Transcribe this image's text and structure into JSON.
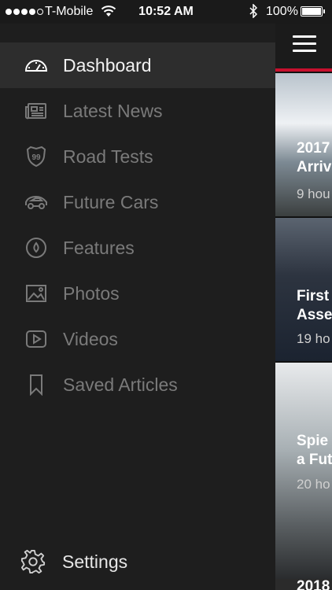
{
  "status_bar": {
    "carrier": "T-Mobile",
    "time": "10:52 AM",
    "battery": "100%"
  },
  "menu": {
    "items": [
      {
        "label": "Dashboard",
        "icon": "speedometer-icon",
        "active": true
      },
      {
        "label": "Latest News",
        "icon": "newspaper-icon",
        "active": false
      },
      {
        "label": "Road Tests",
        "icon": "highway-99-icon",
        "active": false
      },
      {
        "label": "Future Cars",
        "icon": "car-icon",
        "active": false
      },
      {
        "label": "Features",
        "icon": "target-icon",
        "active": false
      },
      {
        "label": "Photos",
        "icon": "photo-icon",
        "active": false
      },
      {
        "label": "Videos",
        "icon": "play-icon",
        "active": false
      },
      {
        "label": "Saved Articles",
        "icon": "bookmark-icon",
        "active": false
      }
    ],
    "road_tests_badge": "99",
    "settings_label": "Settings"
  },
  "articles": [
    {
      "title_line1": "2017",
      "title_line2": "Arriv",
      "time": "9 hou"
    },
    {
      "title_line1": "First",
      "title_line2": "Asse",
      "time": "19 ho"
    },
    {
      "title_line1": "Spie",
      "title_line2": "a Fut",
      "time": "20 ho"
    },
    {
      "title_line1": "2018",
      "title_line2": "",
      "time": ""
    }
  ],
  "colors": {
    "accent": "#c8102e",
    "drawer_bg": "#1e1e1e",
    "active_bg": "#2d2d2d"
  }
}
